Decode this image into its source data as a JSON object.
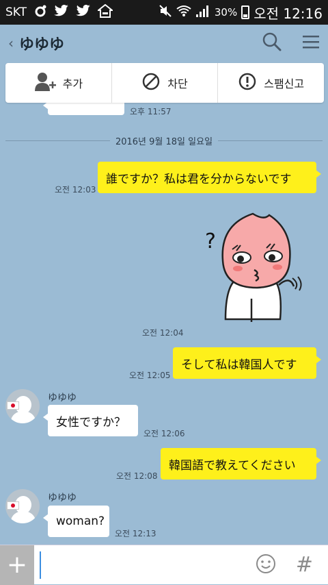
{
  "status_bar": {
    "carrier": "SKT",
    "battery": "30%",
    "time": "오전 12:16"
  },
  "header": {
    "back_glyph": "‹",
    "title": "ゆゆゆ"
  },
  "actions": {
    "add": "추가",
    "block": "차단",
    "report": "스팸신고"
  },
  "partial_message": {
    "time": "오후 11:57"
  },
  "date_separator": "2016년 9월 18일 일요일",
  "messages": [
    {
      "text": "誰ですか？私は君を分からないです",
      "time": "오전 12:03"
    },
    {
      "sticker": true,
      "time": "오전 12:04"
    },
    {
      "text": "そして私は韓国人です",
      "time": "오전 12:05"
    },
    {
      "sender": "ゆゆゆ",
      "text": "女性ですか？",
      "time": "오전 12:06"
    },
    {
      "text": "韓国語で教えてください",
      "time": "오전 12:08"
    },
    {
      "sender": "ゆゆゆ",
      "text": "woman?",
      "time": "오전 12:13"
    }
  ],
  "input": {
    "plus_glyph": "+",
    "placeholder": "",
    "hashtag_glyph": "#"
  },
  "icons": {
    "search": "search-icon",
    "menu": "menu-icon",
    "add_friend": "add-friend-icon",
    "block": "block-icon",
    "report": "report-icon",
    "emoji": "emoji-icon"
  }
}
